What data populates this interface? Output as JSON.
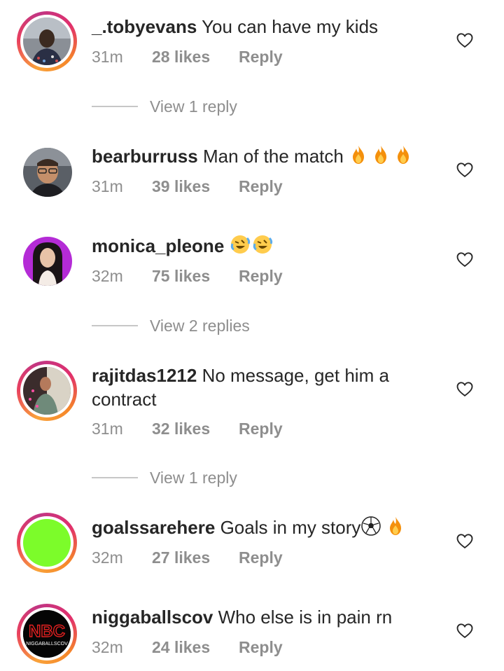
{
  "comments": [
    {
      "username": "_.tobyevans",
      "text": "You can have my kids",
      "time": "31m",
      "likes": "28 likes",
      "reply": "Reply",
      "view_replies": "View 1 reply",
      "avatar": "photo-man-dark",
      "ring": true
    },
    {
      "username": "bearburruss",
      "text": "Man of the match",
      "emojis": [
        "fire",
        "fire",
        "fire"
      ],
      "time": "31m",
      "likes": "39 likes",
      "reply": "Reply",
      "avatar": "photo-man-glasses",
      "ring": false
    },
    {
      "username": "monica_pleone",
      "text": "",
      "emojis": [
        "rolling-laughing",
        "rolling-laughing"
      ],
      "time": "32m",
      "likes": "75 likes",
      "reply": "Reply",
      "view_replies": "View 2 replies",
      "avatar": "photo-woman",
      "ring": false
    },
    {
      "username": "rajitdas1212",
      "text": "No message, get him a",
      "text_line2": "contract",
      "time": "31m",
      "likes": "32 likes",
      "reply": "Reply",
      "view_replies": "View 1 reply",
      "avatar": "photo-man-lights",
      "ring": true
    },
    {
      "username": "goalssarehere",
      "text": "Goals in my story",
      "emojis": [
        "soccer-ball",
        "fire"
      ],
      "time": "32m",
      "likes": "27 likes",
      "reply": "Reply",
      "avatar": "green-circle",
      "ring": true
    },
    {
      "username": "niggaballscov",
      "text": "Who else is in pain rn",
      "time": "32m",
      "likes": "24 likes",
      "reply": "Reply",
      "avatar": "nbc-logo",
      "avatar_logo_text": "NBC",
      "avatar_logo_subtext": "NIGGABALLSCOV",
      "ring": true
    }
  ],
  "colors": {
    "text": "#262626",
    "secondary": "#8e8e8e",
    "ring_start": "#f58529",
    "ring_end": "#c13584",
    "green_avatar": "#7cfc2a"
  }
}
